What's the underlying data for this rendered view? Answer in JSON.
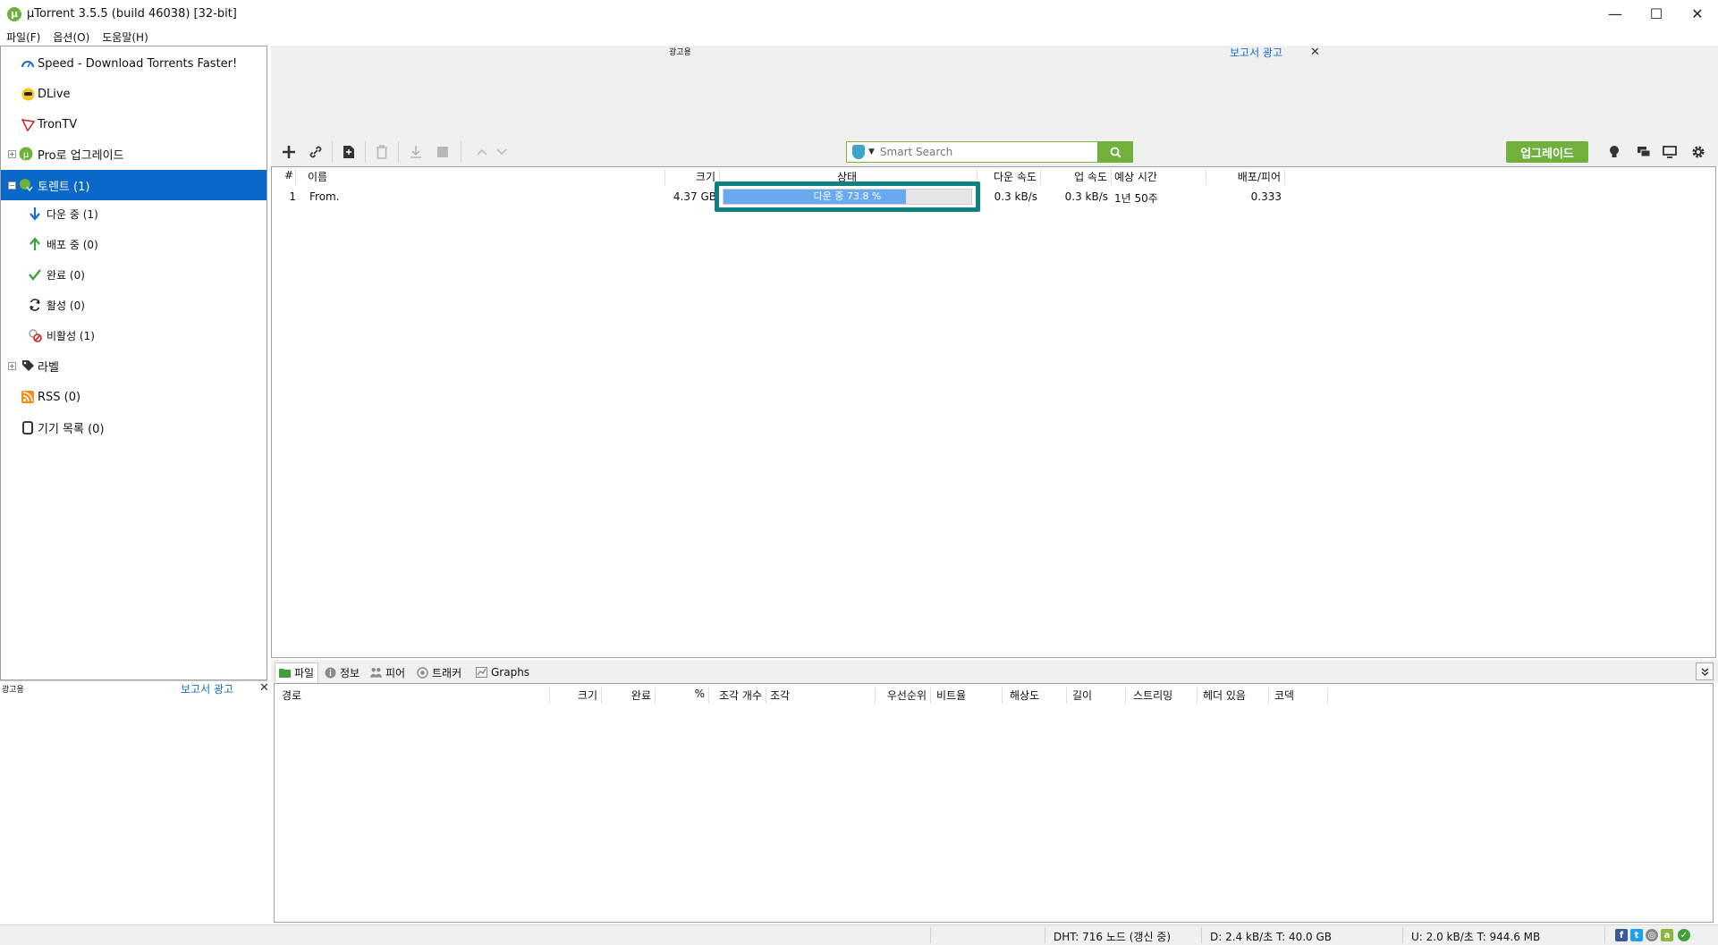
{
  "window": {
    "title": "µTorrent 3.5.5  (build 46038) [32-bit]",
    "minimize": "—",
    "maximize": "☐",
    "close": "✕"
  },
  "menu": [
    "파일(F)",
    "옵션(O)",
    "도움말(H)"
  ],
  "sidebar": {
    "items": [
      {
        "label": "Speed - Download Torrents Faster!",
        "icon": "speedometer-icon"
      },
      {
        "label": "DLive",
        "icon": "dlive-icon"
      },
      {
        "label": "TronTV",
        "icon": "trontv-icon"
      },
      {
        "label": "Pro로 업그레이드",
        "icon": "utorrent-pro-icon"
      },
      {
        "label": "토렌트 (1)",
        "icon": "torrents-icon"
      },
      {
        "label": "다운 중 (1)",
        "icon": "download-arrow-icon"
      },
      {
        "label": "배포 중 (0)",
        "icon": "upload-arrow-icon"
      },
      {
        "label": "완료 (0)",
        "icon": "checkmark-icon"
      },
      {
        "label": "활성 (0)",
        "icon": "refresh-icon"
      },
      {
        "label": "비활성 (1)",
        "icon": "inactive-icon"
      },
      {
        "label": "라벨",
        "icon": "label-tag-icon"
      },
      {
        "label": "RSS (0)",
        "icon": "rss-icon"
      },
      {
        "label": "기기 목록 (0)",
        "icon": "device-icon"
      }
    ],
    "ad": {
      "label": "광고용",
      "report": "보고서 광고",
      "close": "✕"
    }
  },
  "top_ad": {
    "label": "광고용",
    "report": "보고서 광고",
    "close": "✕"
  },
  "toolbar": {
    "search_placeholder": "Smart Search",
    "upgrade_label": "업그레이드"
  },
  "torrent_list": {
    "columns": [
      "#",
      "이름",
      "크기",
      "상태",
      "다운 속도",
      "업 속도",
      "예상 시간",
      "배포/피어"
    ],
    "rows": [
      {
        "num": "1",
        "name": "From.",
        "size": "4.37 GB",
        "status_text": "다운 중 73.8 %",
        "progress": 0.738,
        "down_speed": "0.3 kB/s",
        "up_speed": "0.3 kB/s",
        "eta": "1년 50주",
        "ratio": "0.333"
      }
    ]
  },
  "bottom_tabs": [
    "파일",
    "정보",
    "피어",
    "트래커",
    "Graphs"
  ],
  "files_columns": [
    "경로",
    "크기",
    "완료",
    "%",
    "조각 개수",
    "조각",
    "우선순위",
    "비트율",
    "해상도",
    "길이",
    "스트리밍",
    "헤더 있음",
    "코덱"
  ],
  "status_bar": {
    "dht": "DHT: 716 노드  (갱신 중)",
    "download": "D: 2.4 kB/초 T: 40.0 GB",
    "upload": "U: 2.0 kB/초 T: 944.6 MB"
  },
  "colors": {
    "accent_green": "#6fb13b",
    "selection_blue": "#0a68c8",
    "progress_blue": "#69a9f0",
    "highlight_teal": "#0e8080"
  }
}
